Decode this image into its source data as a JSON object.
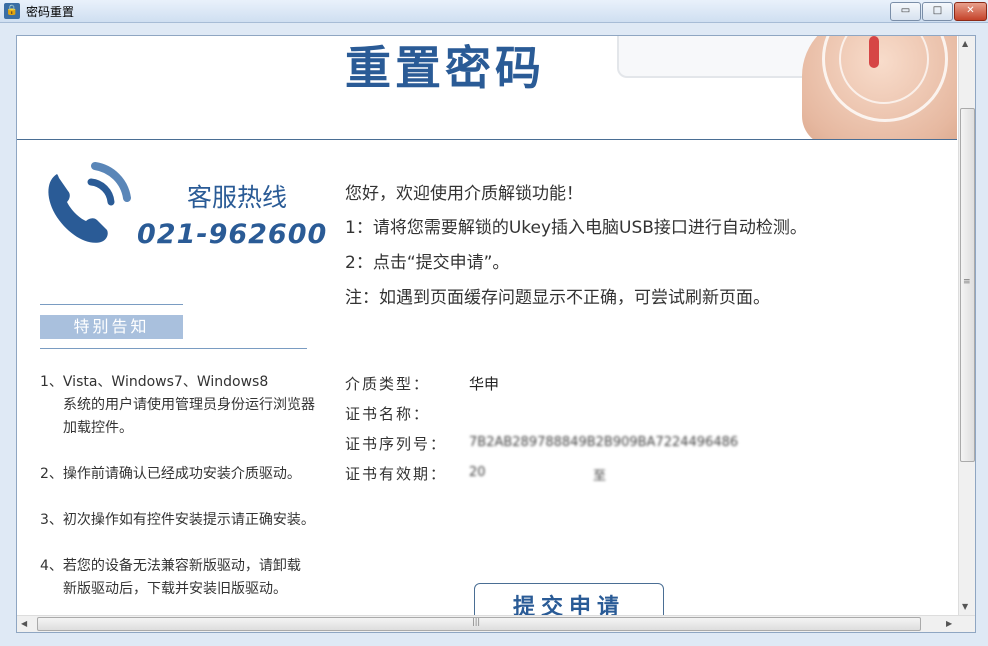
{
  "window": {
    "title": "密码重置",
    "app_icon": "lock-icon",
    "minimize_glyph": "▭",
    "maximize_glyph": "□",
    "close_glyph": "✕"
  },
  "banner": {
    "title": "重置密码"
  },
  "hotline": {
    "label": "客服热线",
    "number": "021-962600",
    "icon": "phone-icon",
    "color": "#2a5b96"
  },
  "notice": {
    "title": "特别告知",
    "items": [
      {
        "first": "1、Vista、Windows7、Windows8",
        "rest": "系统的用户请使用管理员身份运行浏览器加载控件。"
      },
      {
        "first": "2、操作前请确认已经成功安装介质驱动。",
        "rest": ""
      },
      {
        "first": "3、初次操作如有控件安装提示请正确安装。",
        "rest": ""
      },
      {
        "first": "4、若您的设备无法兼容新版驱动，请卸载",
        "rest": "新版驱动后，下载并安装旧版驱动。"
      }
    ]
  },
  "intro": {
    "greeting": "您好，欢迎使用介质解锁功能！",
    "step1": "1：请将您需要解锁的Ukey插入电脑USB接口进行自动检测。",
    "step2": "2：点击“提交申请”。",
    "note": "注：如遇到页面缓存问题显示不正确，可尝试刷新页面。"
  },
  "info": {
    "media_type_label": "介质类型：",
    "media_type_value": "华申",
    "cert_name_label": "证书名称：",
    "cert_name_value": "",
    "cert_serial_label": "证书序列号：",
    "cert_serial_value": "7B2AB289788849B2B909BA7224496486",
    "cert_validity_label": "证书有效期：",
    "cert_validity_value": "20",
    "cert_validity_value2": "至"
  },
  "submit_label": "提交申请",
  "scrollbars": {
    "up": "▲",
    "down": "▼",
    "left": "◀",
    "right": "▶",
    "grip": "≡",
    "hgrip": "|||"
  }
}
